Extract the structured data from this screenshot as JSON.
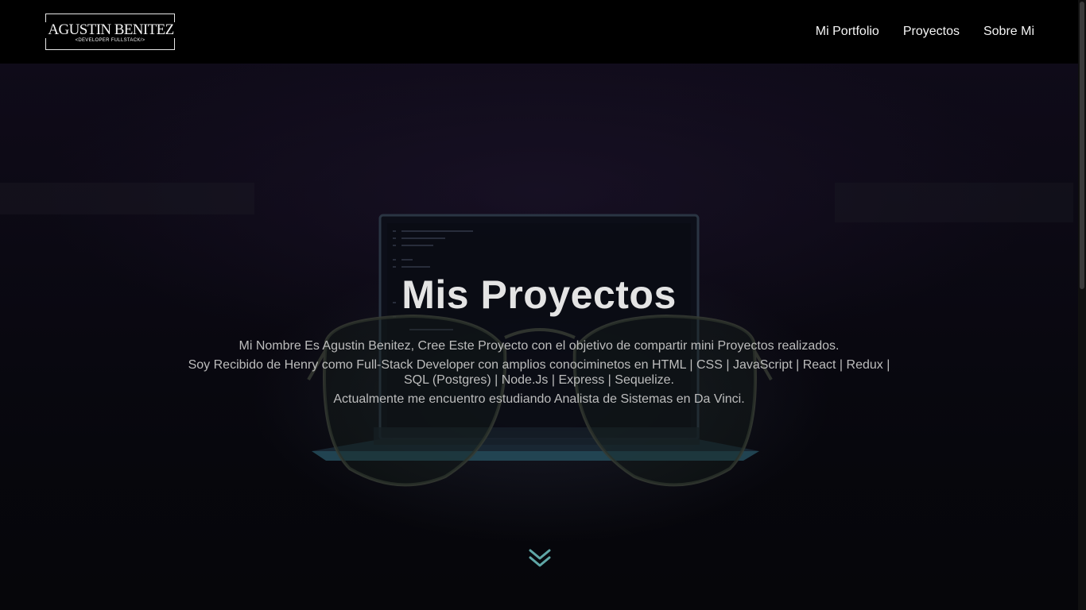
{
  "brand": {
    "name": "AGUSTIN BENITEZ",
    "tagline": "<DEVELOPER FULLSTACK/>"
  },
  "nav": {
    "items": [
      {
        "label": "Mi Portfolio"
      },
      {
        "label": "Proyectos"
      },
      {
        "label": "Sobre Mi"
      }
    ]
  },
  "hero": {
    "title": "Mis Proyectos",
    "paragraph1": "Mi Nombre Es Agustin Benitez, Cree Este Proyecto con el objetivo de compartir mini Proyectos realizados.",
    "paragraph2": "Soy Recibido de Henry como Full-Stack Developer con amplios conociminetos en HTML | CSS | JavaScript | React | Redux | SQL (Postgres) | Node.Js | Express | Sequelize.",
    "paragraph3": "Actualmente me encuentro estudiando Analista de Sistemas en Da Vinci.",
    "scroll_icon": "double-chevron-down-icon"
  },
  "colors": {
    "navbar": "#000000",
    "background": "#07070c",
    "title": "#e4e4e4",
    "text": "#bdbdbd",
    "accent": "#5fa6a6"
  }
}
